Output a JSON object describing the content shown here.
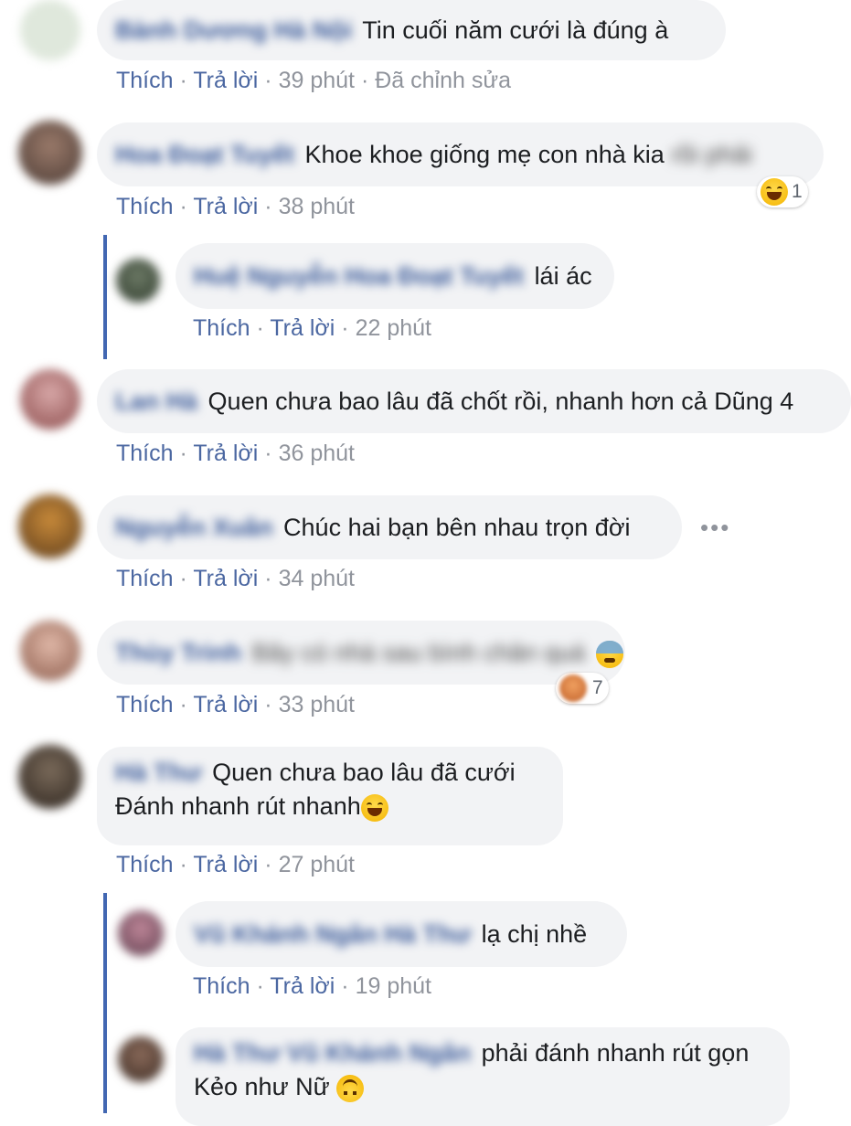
{
  "meta_labels": {
    "like": "Thích",
    "reply": "Trả lời",
    "dot": "·"
  },
  "comments": [
    {
      "name": "Bành Dương Hà Nội",
      "text": "Tin cuối năm cưới là đúng à",
      "time": "39 phút",
      "edited": "Đã chỉnh sửa"
    },
    {
      "name": "Hoa Đoạt Tuyết",
      "text": "Khoe khoe giống mẹ con nhà kia",
      "text_blur": "rồi phải",
      "time": "38 phút",
      "reaction_count": "1",
      "reaction_icon": "laughing-emoji-icon"
    },
    {
      "name": "Huệ Nguyễn Hoa Đoạt Tuyết",
      "text": "lái ác",
      "time": "22 phút"
    },
    {
      "name": "Lan Hà",
      "text": "Quen chưa bao lâu đã chốt rồi, nhanh hơn cả Dũng 4",
      "time": "36 phút"
    },
    {
      "name": "Nguyễn Xuân",
      "text": "Chúc hai bạn bên nhau trọn đời",
      "time": "34 phút",
      "more": "•••"
    },
    {
      "name": "Thùy Trinh",
      "text_blur": "Bây có nhà sau bình chân quá",
      "time": "33 phút",
      "reaction_count": "7",
      "reaction_icon": "sweat-emoji-icon"
    },
    {
      "name": "Hà Thư",
      "text_line1": "Quen chưa bao lâu đã cưới",
      "text_line2": "Đánh nhanh rút nhanh",
      "time": "27 phút",
      "reaction_icon": "tears-of-joy-emoji-icon"
    },
    {
      "name": "Vũ Khánh Ngân Hà Thư",
      "text": "lạ chị nhề",
      "time": "19 phút"
    },
    {
      "name": "Hà Thư Vũ Khánh Ngân",
      "text_line1": "phải đánh nhanh rút gọn",
      "text_line2": "Kẻo như Nữ",
      "reaction_icon": "upside-down-face-icon"
    }
  ],
  "colors": {
    "link": "#4b67a1",
    "bubble": "#f2f3f5",
    "thread": "#4267b2",
    "meta": "#90949c"
  }
}
